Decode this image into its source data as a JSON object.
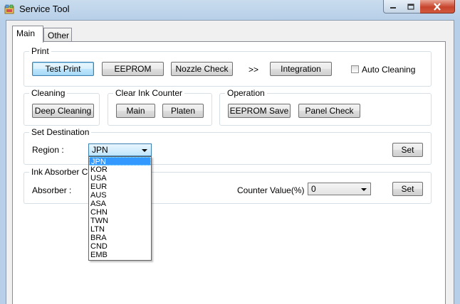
{
  "window": {
    "title": "Service Tool",
    "icon": "service-tool-app-icon",
    "controls": {
      "minimize": "minimize-icon",
      "maximize": "maximize-icon",
      "close": "close-icon"
    }
  },
  "tabs": [
    {
      "label": "Main",
      "active": true
    },
    {
      "label": "Other",
      "active": false
    }
  ],
  "print": {
    "title": "Print",
    "test_print": "Test Print",
    "eeprom": "EEPROM",
    "nozzle_check": "Nozzle Check",
    "arrow": ">>",
    "integration": "Integration",
    "auto_cleaning": "Auto Cleaning",
    "auto_cleaning_checked": false
  },
  "cleaning": {
    "title": "Cleaning",
    "deep_cleaning": "Deep Cleaning"
  },
  "clear_ink_counter": {
    "title": "Clear Ink Counter",
    "main": "Main",
    "platen": "Platen"
  },
  "operation": {
    "title": "Operation",
    "eeprom_save": "EEPROM Save",
    "panel_check": "Panel Check"
  },
  "set_destination": {
    "title": "Set Destination",
    "region_label": "Region :",
    "region_value": "JPN",
    "set": "Set",
    "options": [
      "JPN",
      "KOR",
      "USA",
      "EUR",
      "AUS",
      "ASA",
      "CHN",
      "TWN",
      "LTN",
      "BRA",
      "CND",
      "EMB"
    ],
    "selected_index": 0
  },
  "ink_absorber": {
    "title": "Ink Absorber Co",
    "absorber_label": "Absorber :",
    "counter_label": "Counter Value(%) :",
    "counter_value": "0",
    "set": "Set"
  },
  "colors": {
    "accent": "#3399ff",
    "titlebar": "#b7cfe8",
    "close": "#c7442c"
  }
}
